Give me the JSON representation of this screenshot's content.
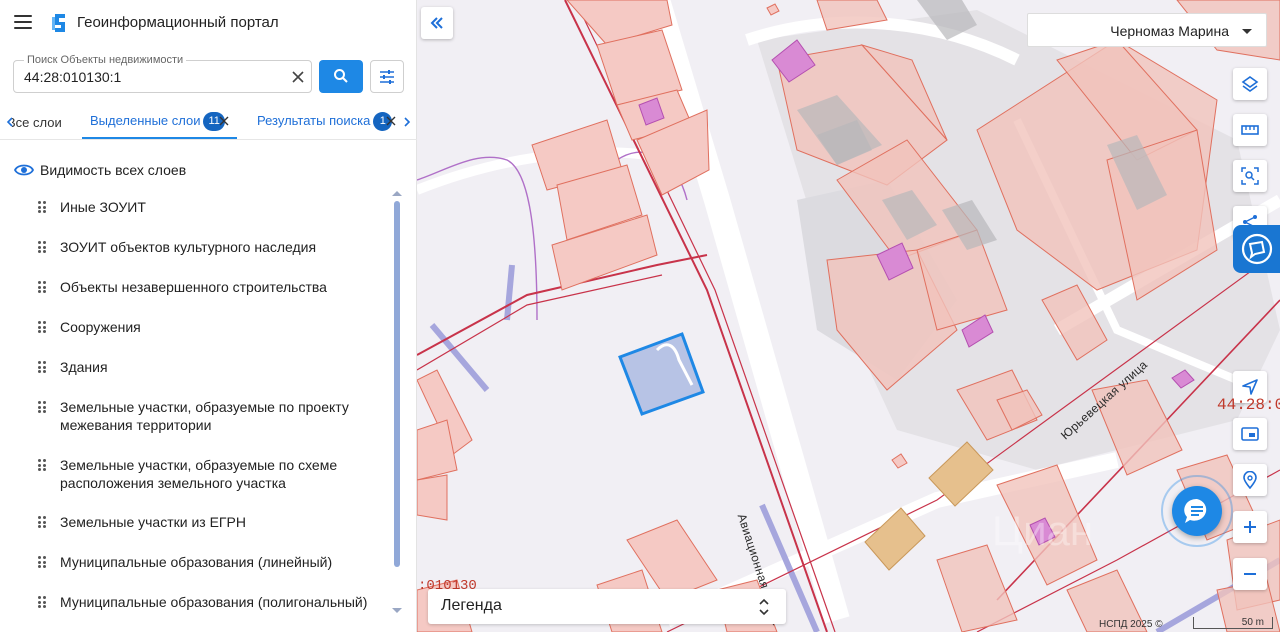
{
  "app": {
    "title": "Геоинформационный портал"
  },
  "search": {
    "label": "Поиск Объекты недвижимости",
    "value": "44:28:010130:1"
  },
  "tabs": [
    {
      "label": "Все слои",
      "badge": ""
    },
    {
      "label": "Выделенные слои",
      "badge": "11"
    },
    {
      "label": "Результаты поиска",
      "badge": "1"
    }
  ],
  "visibility": {
    "label": "Видимость всех слоев"
  },
  "layers": [
    "Иные ЗОУИТ",
    "ЗОУИТ объектов культурного наследия",
    "Объекты незавершенного строительства",
    "Сооружения",
    "Здания",
    "Земельные участки, образуемые по проекту межевания территории",
    "Земельные участки, образуемые по схеме расположения земельного участка",
    "Земельные участки из ЕГРН",
    "Муниципальные образования (линейный)",
    "Муниципальные образования (полигональный)"
  ],
  "user": {
    "name": "Черномаз Марина"
  },
  "legend": {
    "label": "Легенда"
  },
  "map": {
    "streets": {
      "aviation": "Авиационная улица",
      "yurievetskaya": "Юрьевецкая улица"
    },
    "cadastral_right": "44:28:0",
    "cadastral_bottom": ":010130",
    "copyright": "НСПД 2025 ©",
    "scale": "50 m"
  },
  "colors": {
    "accent": "#1e88e5",
    "parcel_fill": "#f5c9c4",
    "parcel_stroke": "#e0705f",
    "road_red": "#c8334a",
    "building": "#d98ad4",
    "selected": "#1e88e5"
  }
}
